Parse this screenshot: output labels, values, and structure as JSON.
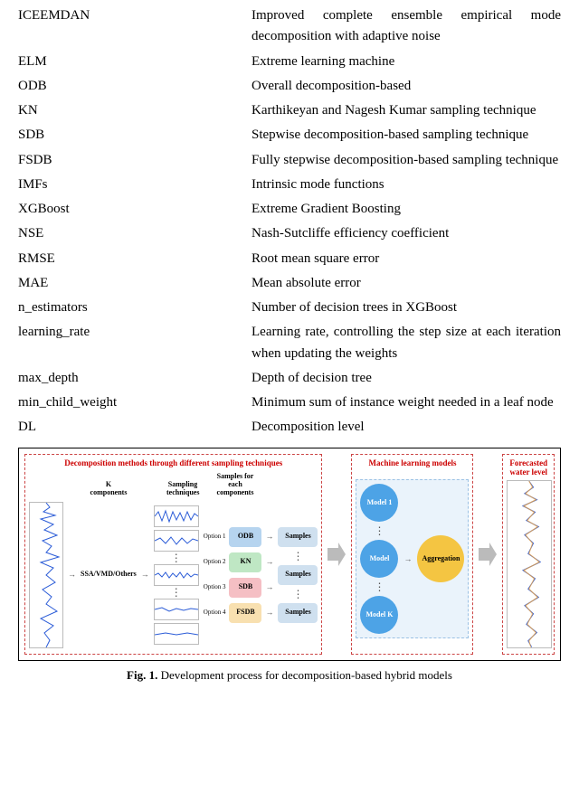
{
  "table": {
    "rows": [
      {
        "term": "ICEEMDAN",
        "def": "Improved complete ensemble empirical mode decomposition with adaptive noise"
      },
      {
        "term": "ELM",
        "def": "Extreme learning machine"
      },
      {
        "term": "ODB",
        "def": "Overall decomposition-based"
      },
      {
        "term": "KN",
        "def": "Karthikeyan and Nagesh Kumar sampling technique"
      },
      {
        "term": "SDB",
        "def": "Stepwise decomposition-based sampling technique"
      },
      {
        "term": "FSDB",
        "def": "Fully stepwise decomposition-based sampling technique"
      },
      {
        "term": "IMFs",
        "def": "Intrinsic mode functions"
      },
      {
        "term": "XGBoost",
        "def": "Extreme Gradient Boosting"
      },
      {
        "term": "NSE",
        "def": "Nash-Sutcliffe efficiency coefficient"
      },
      {
        "term": "RMSE",
        "def": "Root mean square error"
      },
      {
        "term": "MAE",
        "def": "Mean absolute error"
      },
      {
        "term": "n_estimators",
        "def": "Number of decision trees in XGBoost"
      },
      {
        "term": "learning_rate",
        "def": "Learning rate, controlling the step size at each iteration when updating the weights"
      },
      {
        "term": "max_depth",
        "def": "Depth of decision tree"
      },
      {
        "term": "min_child_weight",
        "def": "Minimum sum of instance weight needed in a leaf node"
      },
      {
        "term": "DL",
        "def": "Decomposition level"
      }
    ]
  },
  "figure": {
    "caption_label": "Fig. 1.",
    "caption_text": " Development process for decomposition-based hybrid models",
    "decomp_title": "Decomposition methods through different sampling techniques",
    "ml_title": "Machine learning models",
    "out_title": "Forecasted water level",
    "input_label": "SSA/VMD/Others",
    "kcomp_label": "K components",
    "sampling_label": "Sampling techniques",
    "samples_label": "Samples for each components",
    "options": [
      {
        "opt": "Option 1",
        "name": "ODB",
        "cls": "clr-odb"
      },
      {
        "opt": "Option 2",
        "name": "KN",
        "cls": "clr-kn"
      },
      {
        "opt": "Option 3",
        "name": "SDB",
        "cls": "clr-sdb"
      },
      {
        "opt": "Option 4",
        "name": "FSDB",
        "cls": "clr-fsdb"
      }
    ],
    "samples_text": "Samples",
    "models": [
      "Model 1",
      "Model",
      "Model K"
    ],
    "agg": "Aggregation"
  }
}
